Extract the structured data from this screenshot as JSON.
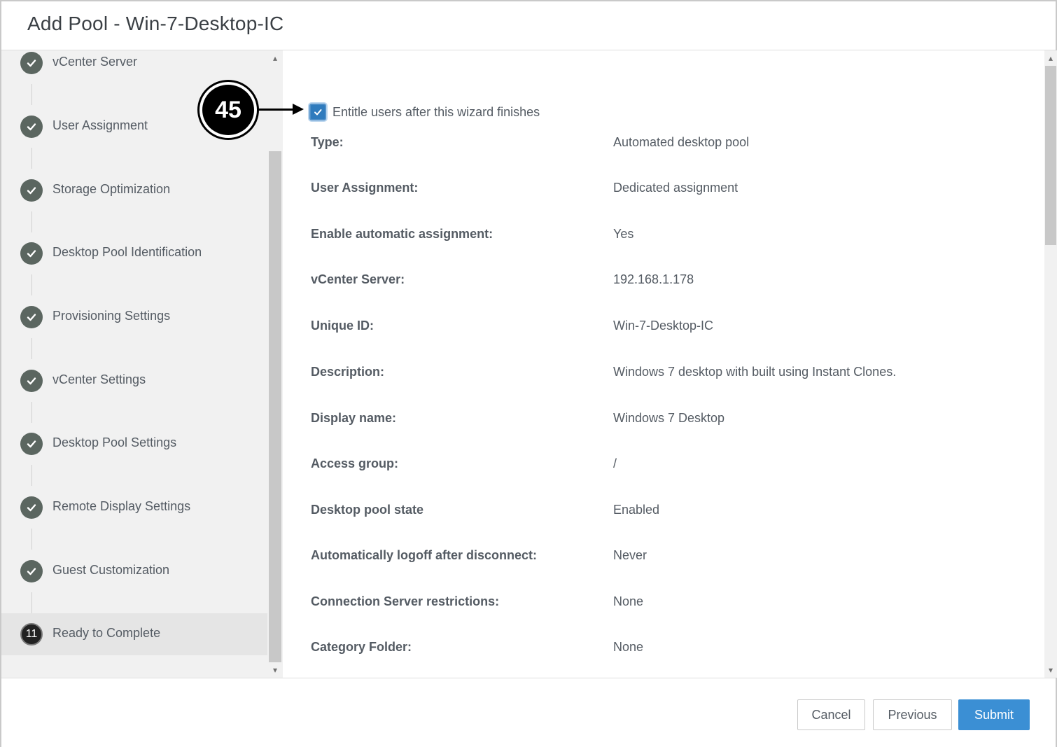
{
  "dialog": {
    "title": "Add Pool - Win-7-Desktop-IC"
  },
  "sidebar": {
    "steps": [
      {
        "label": "vCenter Server",
        "state": "done"
      },
      {
        "label": "User Assignment",
        "state": "done"
      },
      {
        "label": "Storage Optimization",
        "state": "done"
      },
      {
        "label": "Desktop Pool Identification",
        "state": "done"
      },
      {
        "label": "Provisioning Settings",
        "state": "done"
      },
      {
        "label": "vCenter Settings",
        "state": "done"
      },
      {
        "label": "Desktop Pool Settings",
        "state": "done"
      },
      {
        "label": "Remote Display Settings",
        "state": "done"
      },
      {
        "label": "Guest Customization",
        "state": "done"
      },
      {
        "label": "Ready to Complete",
        "state": "active",
        "number": "11"
      }
    ]
  },
  "main": {
    "entitle": {
      "label": "Entitle users after this wizard finishes",
      "checked": true
    },
    "summary": [
      {
        "label": "Type:",
        "value": "Automated desktop pool"
      },
      {
        "label": "User Assignment:",
        "value": "Dedicated assignment"
      },
      {
        "label": "Enable automatic assignment:",
        "value": "Yes"
      },
      {
        "label": "vCenter Server:",
        "value": "192.168.1.178"
      },
      {
        "label": "Unique ID:",
        "value": "Win-7-Desktop-IC"
      },
      {
        "label": "Description:",
        "value": "Windows 7 desktop with built using Instant Clones."
      },
      {
        "label": "Display name:",
        "value": "Windows 7 Desktop"
      },
      {
        "label": "Access group:",
        "value": "/"
      },
      {
        "label": "Desktop pool state",
        "value": "Enabled"
      },
      {
        "label": "Automatically logoff after disconnect:",
        "value": "Never"
      },
      {
        "label": "Connection Server restrictions:",
        "value": "None"
      },
      {
        "label": "Category Folder:",
        "value": "None"
      }
    ]
  },
  "footer": {
    "cancel_label": "Cancel",
    "previous_label": "Previous",
    "submit_label": "Submit"
  },
  "callout": {
    "number": "45"
  },
  "colors": {
    "primary": "#3b8fd4",
    "step_done": "#5b6660",
    "sidebar_bg": "#f1f1f1"
  }
}
